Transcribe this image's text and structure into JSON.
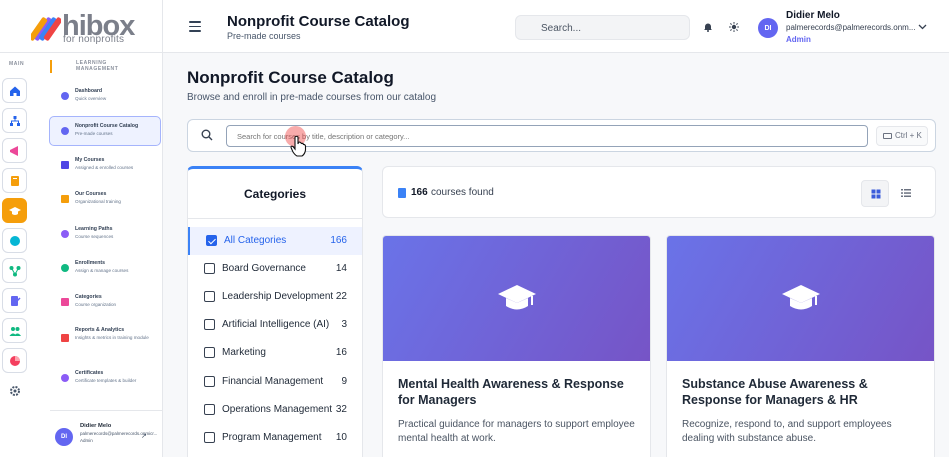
{
  "logo": {
    "word": "hibox",
    "sub": "for nonprofits"
  },
  "rail": {
    "label": "MAIN"
  },
  "nav": {
    "section": "LEARNING MANAGEMENT",
    "items": [
      {
        "title": "Dashboard",
        "sub": "Quick overview",
        "color": "#6366f1"
      },
      {
        "title": "Nonprofit Course Catalog",
        "sub": "Pre-made courses",
        "color": "#6366f1"
      },
      {
        "title": "My Courses",
        "sub": "Assigned & enrolled courses",
        "color": "#4f46e5"
      },
      {
        "title": "Our Courses",
        "sub": "Organizational training",
        "color": "#f59e0b"
      },
      {
        "title": "Learning Paths",
        "sub": "Course sequences",
        "color": "#8b5cf6"
      },
      {
        "title": "Enrollments",
        "sub": "Assign & manage courses",
        "color": "#10b981"
      },
      {
        "title": "Categories",
        "sub": "Course organization",
        "color": "#ec4899"
      },
      {
        "title": "Reports & Analytics",
        "sub": "Insights & metrics in training module",
        "color": "#ef4444"
      },
      {
        "title": "Certificates",
        "sub": "Certificate templates & builder",
        "color": "#8b5cf6"
      }
    ],
    "user": {
      "initials": "DI",
      "name": "Didier Melo",
      "email": "palmerecords@palmerecords.onmicr...",
      "role": "Admin"
    }
  },
  "header": {
    "title": "Nonprofit Course Catalog",
    "subtitle": "Pre-made courses",
    "search_placeholder": "Search...",
    "user": {
      "initials": "DI",
      "name": "Didier Melo",
      "email": "palmerecords@palmerecords.onm...",
      "role": "Admin"
    }
  },
  "main": {
    "title": "Nonprofit Course Catalog",
    "subtitle": "Browse and enroll in pre-made courses from our catalog",
    "search_placeholder": "Search for courses by title, description or category...",
    "shortcut": "Ctrl + K"
  },
  "categories": {
    "heading": "Categories",
    "items": [
      {
        "name": "All Categories",
        "count": "166",
        "checked": true
      },
      {
        "name": "Board Governance",
        "count": "14",
        "checked": false
      },
      {
        "name": "Leadership Development",
        "count": "22",
        "checked": false
      },
      {
        "name": "Artificial Intelligence (AI)",
        "count": "3",
        "checked": false
      },
      {
        "name": "Marketing",
        "count": "16",
        "checked": false
      },
      {
        "name": "Financial Management",
        "count": "9",
        "checked": false
      },
      {
        "name": "Operations Management",
        "count": "32",
        "checked": false
      },
      {
        "name": "Program Management",
        "count": "10",
        "checked": false
      }
    ]
  },
  "results": {
    "count": "166",
    "label": "courses found"
  },
  "cards": [
    {
      "title": "Mental Health Awareness & Response for Managers",
      "desc": "Practical guidance for managers to support employee mental health at work."
    },
    {
      "title": "Substance Abuse Awareness & Response for Managers & HR",
      "desc": "Recognize, respond to, and support employees dealing with substance abuse."
    }
  ]
}
